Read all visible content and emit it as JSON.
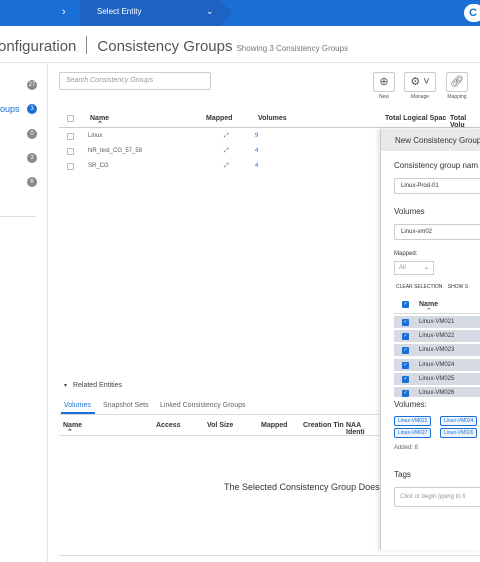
{
  "topbar": {
    "entity_label": "Select Entity",
    "right_glyph": "C"
  },
  "header": {
    "section": "onfiguration",
    "title": "Consistency Groups",
    "subtitle": "Showing 3 Consistency Groups"
  },
  "leftnav": {
    "items": [
      {
        "label": "",
        "count": "27",
        "active": false
      },
      {
        "label": "oups",
        "count": "3",
        "active": true
      },
      {
        "label": "",
        "count": "0",
        "active": false
      },
      {
        "label": "",
        "count": "3",
        "active": false
      },
      {
        "label": "",
        "count": "6",
        "active": false
      }
    ]
  },
  "search": {
    "placeholder": "Search Consistency Groups"
  },
  "toolbar": {
    "new_label": "New",
    "manage_label": "Manage",
    "mapping_label": "Mapping"
  },
  "table": {
    "columns": [
      "Name",
      "Mapped",
      "Volumes",
      "Total Logical Spac",
      "Total Volu"
    ],
    "rows": [
      {
        "name": "Linux",
        "volumes": "9"
      },
      {
        "name": "NR_test_CG_57_58",
        "volumes": "4"
      },
      {
        "name": "SR_CG",
        "volumes": "4"
      }
    ]
  },
  "related": {
    "title": "Related Entities",
    "tabs": [
      "Volumes",
      "Snapshot Sets",
      "Linked Consistency Groups"
    ],
    "columns": [
      "Name",
      "Access",
      "Vol Size",
      "Mapped",
      "Creation Tin",
      "NAA Identi"
    ],
    "empty_message": "The Selected Consistency Group Does"
  },
  "panel": {
    "title": "New Consistency Group",
    "name_label": "Consistency group nam",
    "name_value": "Linux-Prod-01",
    "volumes_label": "Volumes",
    "volumes_value": "Linux-vm02",
    "mapped_label": "Mapped:",
    "mapped_value": "All",
    "clear_selection": "CLEAR SELECTION",
    "show_selected": "SHOW S",
    "list_header": "Name",
    "volumes": [
      "Linux-VM021",
      "Linux-VM022",
      "Linux-VM023",
      "Linux-VM024",
      "Linux-VM025",
      "Linux-VM026"
    ],
    "selected_label": "Volumes:",
    "tags": [
      "Linux-VM022",
      "Linux-VM024",
      "Linux-VM027",
      "Linux-VM026"
    ],
    "added": "Added: 8",
    "tags_label": "Tags",
    "tags_placeholder": "Click or begin typing to fi"
  }
}
